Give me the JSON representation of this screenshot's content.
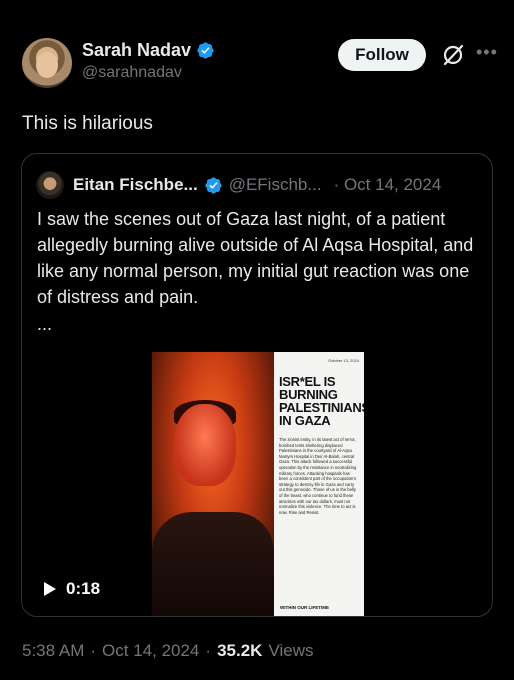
{
  "author": {
    "display_name": "Sarah Nadav",
    "handle": "@sarahnadav"
  },
  "actions": {
    "follow_label": "Follow"
  },
  "tweet": {
    "text": "This is hilarious"
  },
  "quoted": {
    "display_name": "Eitan Fischbe...",
    "handle": "@EFischb...",
    "separator": "·",
    "date": "Oct 14, 2024",
    "body": "I saw the scenes out of Gaza last night, of a patient allegedly burning alive outside of Al Aqsa Hospital, and like any normal person, my initial gut reaction was one of distress and pain.",
    "ellipsis": "...",
    "media": {
      "duration": "0:18",
      "panel_date": "October 13, 2024",
      "panel_headline": "ISR*EL IS BURNING PALESTINIANS IN GAZA",
      "panel_text": "The zionist entity, in its latest act of terror, bombed tents sheltering displaced Palestinians in the courtyard of Al-Aqsa Martyrs Hospital in Deir Al-Balah, central Gaza. This attack followed a successful operation by the resistance in neutralizing military forces. Attacking hospitals has been a consistent part of the occupation's strategy to destroy life in Gaza and carry out this genocide. Those of us in the belly of the beast, who continue to fund these atrocities with our tax dollars, must not normalize this violence. The time to act is now. Rise and Resist.",
      "panel_logo": "WITHIN OUR LIFETIME"
    }
  },
  "footer": {
    "time": "5:38 AM",
    "separator": "·",
    "date": "Oct 14, 2024",
    "separator2": "·",
    "views_count": "35.2K",
    "views_label": "Views"
  },
  "colors": {
    "background": "#000000",
    "text_primary": "#e7e9ea",
    "text_secondary": "#71767b",
    "verified_blue": "#1d9bf0",
    "border": "#2f3336"
  }
}
